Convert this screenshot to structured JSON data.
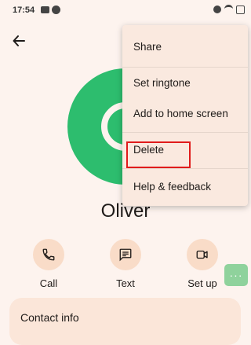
{
  "status_bar": {
    "time": "17:54"
  },
  "contact": {
    "name": "Oliver"
  },
  "actions": [
    {
      "label": "Call",
      "icon": "phone-icon"
    },
    {
      "label": "Text",
      "icon": "message-icon"
    },
    {
      "label": "Set up",
      "icon": "video-icon"
    }
  ],
  "more_button": {
    "label": "···"
  },
  "contact_card": {
    "title": "Contact info"
  },
  "menu": {
    "items": [
      {
        "label": "Share"
      },
      {
        "label": "Set ringtone"
      },
      {
        "label": "Add to home screen"
      },
      {
        "label": "Delete"
      },
      {
        "label": "Help & feedback"
      }
    ]
  },
  "colors": {
    "background": "#fdf3ee",
    "avatar": "#2dbd6e",
    "action_circle": "#f9dcc8",
    "menu_background": "#fae9df",
    "highlight": "#e01b1b"
  }
}
